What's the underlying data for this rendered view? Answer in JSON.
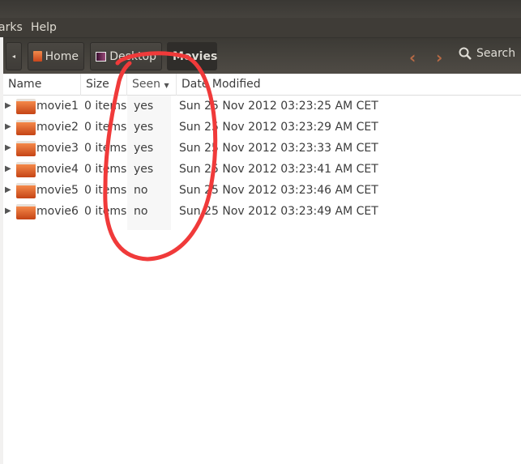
{
  "menubar": {
    "items": [
      "arks",
      "Help"
    ]
  },
  "breadcrumb": {
    "items": [
      "Home",
      "Desktop",
      "Movies"
    ]
  },
  "toolbar": {
    "search_label": "Search"
  },
  "columns": [
    "Name",
    "Size",
    "Seen",
    "Date Modified"
  ],
  "rows": [
    {
      "name": "movie1",
      "size": "0 items",
      "seen": "yes",
      "date": "Sun 25 Nov 2012 03:23:25 AM CET"
    },
    {
      "name": "movie2",
      "size": "0 items",
      "seen": "yes",
      "date": "Sun 25 Nov 2012 03:23:29 AM CET"
    },
    {
      "name": "movie3",
      "size": "0 items",
      "seen": "yes",
      "date": "Sun 25 Nov 2012 03:23:33 AM CET"
    },
    {
      "name": "movie4",
      "size": "0 items",
      "seen": "yes",
      "date": "Sun 25 Nov 2012 03:23:41 AM CET"
    },
    {
      "name": "movie5",
      "size": "0 items",
      "seen": "no",
      "date": "Sun 25 Nov 2012 03:23:46 AM CET"
    },
    {
      "name": "movie6",
      "size": "0 items",
      "seen": "no",
      "date": "Sun 25 Nov 2012 03:23:49 AM CET"
    }
  ],
  "colors": {
    "annotation": "#f03a3a",
    "folder": "#e0642a",
    "nav_arrow": "#b86a45"
  }
}
